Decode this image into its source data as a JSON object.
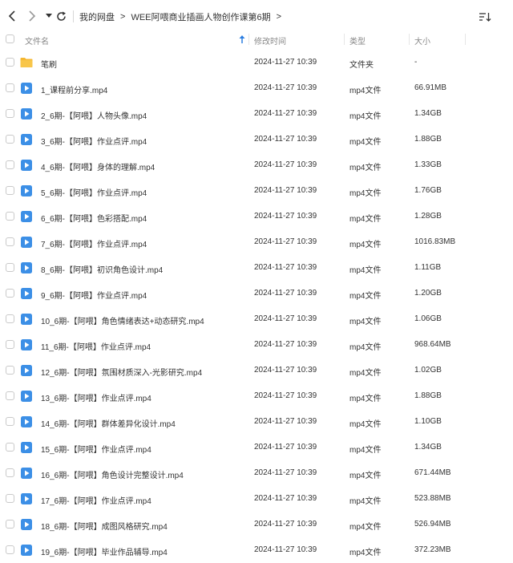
{
  "breadcrumb": {
    "root": "我的网盘",
    "current": "WEE阿喂商业插画人物创作课第6期"
  },
  "columns": {
    "name": "文件名",
    "modified": "修改时间",
    "type": "类型",
    "size": "大小"
  },
  "colors": {
    "folder": "#f5b731",
    "video_icon": "#3c8fe6",
    "sort_arrow": "#2a7de1"
  },
  "files": [
    {
      "name": "笔刷",
      "date": "2024-11-27 10:39",
      "type": "文件夹",
      "size": "-",
      "icon": "folder-icon"
    },
    {
      "name": "1_课程前分享.mp4",
      "date": "2024-11-27 10:39",
      "type": "mp4文件",
      "size": "66.91MB",
      "icon": "video-file-icon"
    },
    {
      "name": "2_6期-【阿喂】人物头像.mp4",
      "date": "2024-11-27 10:39",
      "type": "mp4文件",
      "size": "1.34GB",
      "icon": "video-file-icon"
    },
    {
      "name": "3_6期-【阿喂】作业点评.mp4",
      "date": "2024-11-27 10:39",
      "type": "mp4文件",
      "size": "1.88GB",
      "icon": "video-file-icon"
    },
    {
      "name": "4_6期-【阿喂】身体的理解.mp4",
      "date": "2024-11-27 10:39",
      "type": "mp4文件",
      "size": "1.33GB",
      "icon": "video-file-icon"
    },
    {
      "name": "5_6期-【阿喂】作业点评.mp4",
      "date": "2024-11-27 10:39",
      "type": "mp4文件",
      "size": "1.76GB",
      "icon": "video-file-icon"
    },
    {
      "name": "6_6期-【阿喂】色彩搭配.mp4",
      "date": "2024-11-27 10:39",
      "type": "mp4文件",
      "size": "1.28GB",
      "icon": "video-file-icon"
    },
    {
      "name": "7_6期-【阿喂】作业点评.mp4",
      "date": "2024-11-27 10:39",
      "type": "mp4文件",
      "size": "1016.83MB",
      "icon": "video-file-icon"
    },
    {
      "name": "8_6期-【阿喂】初识角色设计.mp4",
      "date": "2024-11-27 10:39",
      "type": "mp4文件",
      "size": "1.11GB",
      "icon": "video-file-icon"
    },
    {
      "name": "9_6期-【阿喂】作业点评.mp4",
      "date": "2024-11-27 10:39",
      "type": "mp4文件",
      "size": "1.20GB",
      "icon": "video-file-icon"
    },
    {
      "name": "10_6期-【阿喂】角色情绪表达+动态研究.mp4",
      "date": "2024-11-27 10:39",
      "type": "mp4文件",
      "size": "1.06GB",
      "icon": "video-file-icon"
    },
    {
      "name": "11_6期-【阿喂】作业点评.mp4",
      "date": "2024-11-27 10:39",
      "type": "mp4文件",
      "size": "968.64MB",
      "icon": "video-file-icon"
    },
    {
      "name": "12_6期-【阿喂】氛围材质深入-光影研究.mp4",
      "date": "2024-11-27 10:39",
      "type": "mp4文件",
      "size": "1.02GB",
      "icon": "video-file-icon"
    },
    {
      "name": "13_6期-【阿喂】作业点评.mp4",
      "date": "2024-11-27 10:39",
      "type": "mp4文件",
      "size": "1.88GB",
      "icon": "video-file-icon"
    },
    {
      "name": "14_6期-【阿喂】群体差异化设计.mp4",
      "date": "2024-11-27 10:39",
      "type": "mp4文件",
      "size": "1.10GB",
      "icon": "video-file-icon"
    },
    {
      "name": "15_6期-【阿喂】作业点评.mp4",
      "date": "2024-11-27 10:39",
      "type": "mp4文件",
      "size": "1.34GB",
      "icon": "video-file-icon"
    },
    {
      "name": "16_6期-【阿喂】角色设计完整设计.mp4",
      "date": "2024-11-27 10:39",
      "type": "mp4文件",
      "size": "671.44MB",
      "icon": "video-file-icon"
    },
    {
      "name": "17_6期-【阿喂】作业点评.mp4",
      "date": "2024-11-27 10:39",
      "type": "mp4文件",
      "size": "523.88MB",
      "icon": "video-file-icon"
    },
    {
      "name": "18_6期-【阿喂】成图风格研究.mp4",
      "date": "2024-11-27 10:39",
      "type": "mp4文件",
      "size": "526.94MB",
      "icon": "video-file-icon"
    },
    {
      "name": "19_6期-【阿喂】毕业作品辅导.mp4",
      "date": "2024-11-27 10:39",
      "type": "mp4文件",
      "size": "372.23MB",
      "icon": "video-file-icon"
    }
  ]
}
